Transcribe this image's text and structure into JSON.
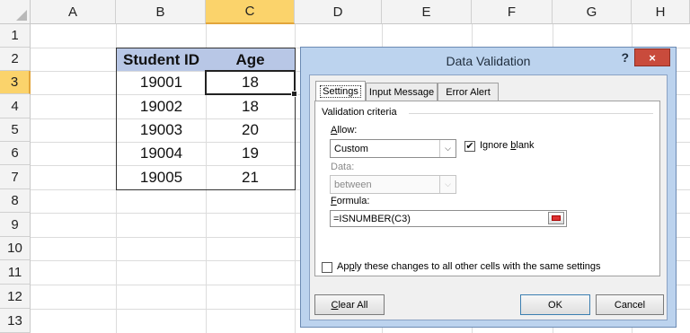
{
  "spreadsheet": {
    "columns": [
      "A",
      "B",
      "C",
      "D",
      "E",
      "F",
      "G",
      "H"
    ],
    "selected_column": "C",
    "rows": [
      "1",
      "2",
      "3",
      "4",
      "5",
      "6",
      "7",
      "8",
      "9",
      "10",
      "11",
      "12",
      "13"
    ],
    "selected_row": "3",
    "table": {
      "headers": [
        "Student ID",
        "Age"
      ],
      "rows": [
        [
          "19001",
          "18"
        ],
        [
          "19002",
          "18"
        ],
        [
          "19003",
          "20"
        ],
        [
          "19004",
          "19"
        ],
        [
          "19005",
          "21"
        ]
      ]
    },
    "header_fill_color": "#b8c7e6",
    "selection_color": "#fbd36b"
  },
  "dialog": {
    "title": "Data Validation",
    "help_label": "?",
    "close_label": "×",
    "tabs": [
      "Settings",
      "Input Message",
      "Error Alert"
    ],
    "active_tab": "Settings",
    "section_label": "Validation criteria",
    "allow_label": "Allow:",
    "allow_value": "Custom",
    "ignore_blank_label": "Ignore blank",
    "ignore_blank_checked": true,
    "data_label": "Data:",
    "data_value": "between",
    "formula_label": "Formula:",
    "formula_value": "=ISNUMBER(C3)",
    "apply_all_label": "Apply these changes to all other cells with the same settings",
    "apply_all_checked": false,
    "clear_all_label": "Clear All",
    "ok_label": "OK",
    "cancel_label": "Cancel",
    "close_button_color": "#c94b3c"
  }
}
